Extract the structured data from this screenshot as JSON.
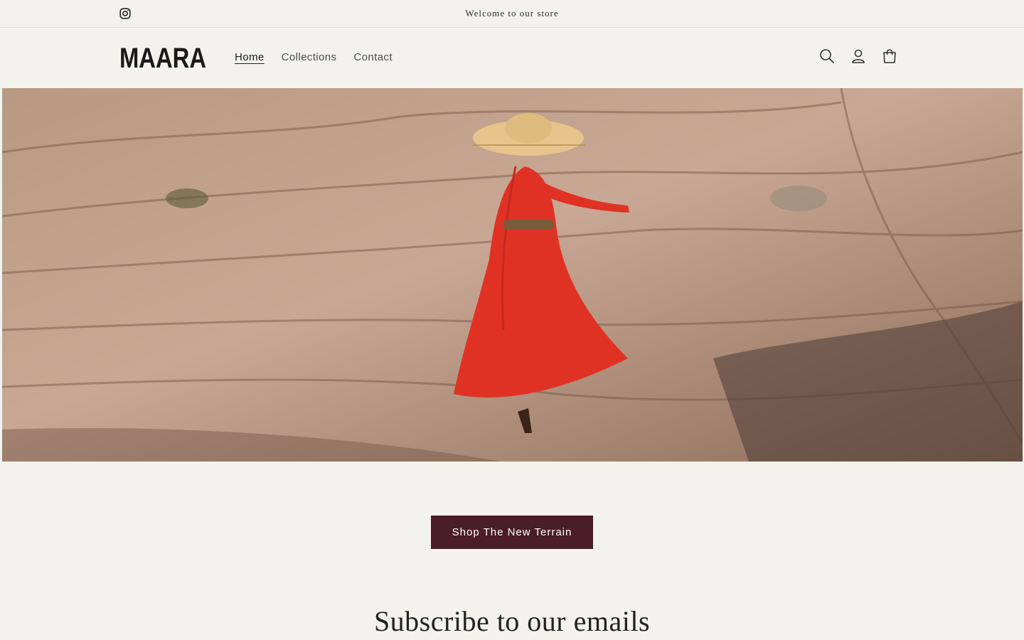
{
  "announcement": {
    "text": "Welcome to our store",
    "social_icon": "instagram-icon"
  },
  "header": {
    "logo_text": "MAARA",
    "nav": [
      {
        "label": "Home",
        "active": true
      },
      {
        "label": "Collections",
        "active": false
      },
      {
        "label": "Contact",
        "active": false
      }
    ],
    "icons": [
      "search-icon",
      "account-icon",
      "cart-icon"
    ]
  },
  "hero": {
    "image_subject": "woman in red dress and straw hat on rock cliff",
    "cta_label": "Shop The New Terrain",
    "cta_color": "#4a1d28"
  },
  "newsletter": {
    "heading": "Subscribe to our emails"
  },
  "colors": {
    "background": "#f4f2ec",
    "accent": "#4a1d28",
    "text": "#222222"
  }
}
